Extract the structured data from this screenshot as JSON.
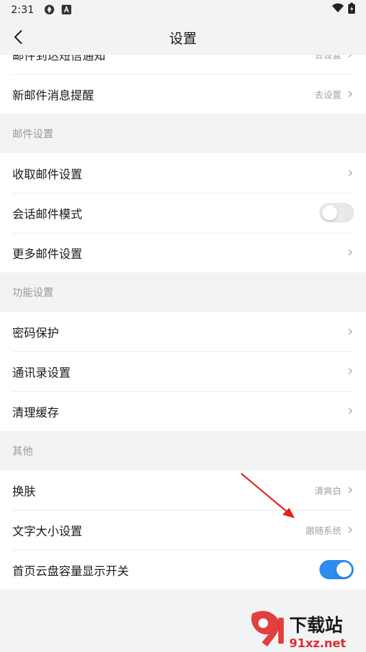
{
  "status_bar": {
    "time": "2:31"
  },
  "nav": {
    "title": "设置"
  },
  "top_partial_row": {
    "label": "邮件到达短信通知",
    "value": "去设置"
  },
  "groups": [
    {
      "rows": [
        {
          "label": "新邮件消息提醒",
          "value": "去设置"
        }
      ]
    }
  ],
  "sections": {
    "mail": {
      "header": "邮件设置",
      "rows": [
        {
          "label": "收取邮件设置"
        },
        {
          "label": "会话邮件模式",
          "toggle": "off"
        },
        {
          "label": "更多邮件设置"
        }
      ]
    },
    "features": {
      "header": "功能设置",
      "rows": [
        {
          "label": "密码保护"
        },
        {
          "label": "通讯录设置"
        },
        {
          "label": "清理缓存"
        }
      ]
    },
    "other": {
      "header": "其他",
      "rows": [
        {
          "label": "换肤",
          "value": "清爽白"
        },
        {
          "label": "文字大小设置",
          "value": "跟随系统"
        },
        {
          "label": "首页云盘容量显示开关",
          "toggle": "on"
        }
      ]
    }
  },
  "watermark": {
    "text": "下载站",
    "url_text": "91xz.net"
  },
  "colors": {
    "accent": "#2d8cf0",
    "background": "#f2f3f5",
    "annotation_arrow": "#e0201f"
  },
  "icons": {
    "back": "back-arrow-icon",
    "chevron": "chevron-right-icon"
  }
}
